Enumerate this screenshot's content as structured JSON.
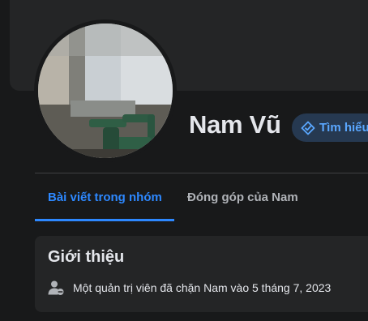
{
  "profile": {
    "name": "Nam Vũ",
    "learn_more_label": "Tìm hiểu"
  },
  "tabs": [
    {
      "label": "Bài viết trong nhóm",
      "active": true
    },
    {
      "label": "Đóng góp của Nam",
      "active": false
    }
  ],
  "intro": {
    "title": "Giới thiệu",
    "items": [
      {
        "icon": "admin-block-icon",
        "text": "Một quản trị viên đã chặn Nam vào 5 tháng 7, 2023"
      }
    ]
  },
  "colors": {
    "background": "#18191a",
    "card": "#242526",
    "accent": "#2d88ff",
    "primary_text": "#e4e6eb",
    "secondary_text": "#b0b3b8"
  }
}
